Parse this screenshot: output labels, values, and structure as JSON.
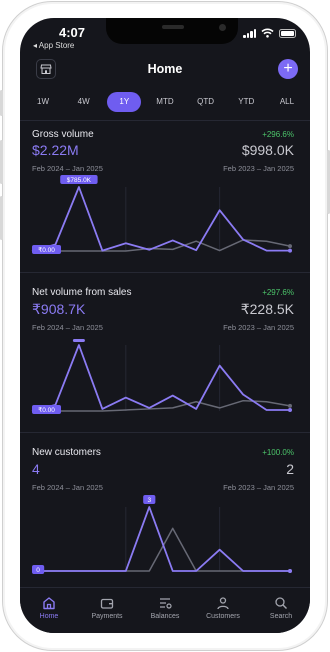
{
  "status": {
    "time": "4:07",
    "back_app": "◂ App Store"
  },
  "header": {
    "title": "Home",
    "add_label": "+"
  },
  "tabs": [
    "1W",
    "4W",
    "1Y",
    "MTD",
    "QTD",
    "YTD",
    "ALL"
  ],
  "active_tab": "1Y",
  "cards": [
    {
      "title": "Gross volume",
      "change": "+296.6%",
      "value": "$2.22M",
      "previous": "$998.0K",
      "range_current": "Feb 2024 – Jan 2025",
      "range_previous": "Feb 2023 – Jan 2025",
      "chart_data": {
        "type": "line",
        "max_label": "$785.0K",
        "min_label": "₹0.00",
        "series": [
          {
            "values": [
              0,
              80,
              785,
              5,
              95,
              15,
              130,
              10,
              500,
              140,
              5,
              5
            ]
          },
          {
            "values": [
              0,
              0,
              0,
              0,
              0,
              30,
              20,
              120,
              5,
              135,
              120,
              60
            ]
          }
        ]
      }
    },
    {
      "title": "Net volume from sales",
      "change": "+297.6%",
      "value": "₹908.7K",
      "previous": "₹228.5K",
      "range_current": "Feb 2024 – Jan 2025",
      "range_previous": "Feb 2023 – Jan 2025",
      "chart_data": {
        "type": "line",
        "max_label": "",
        "min_label": "₹0.00",
        "series": [
          {
            "values": [
              0,
              30,
              320,
              10,
              65,
              15,
              75,
              10,
              220,
              80,
              5,
              5
            ]
          },
          {
            "values": [
              0,
              0,
              0,
              0,
              5,
              10,
              15,
              45,
              15,
              50,
              45,
              25
            ]
          }
        ]
      }
    },
    {
      "title": "New customers",
      "change": "+100.0%",
      "value": "4",
      "previous": "2",
      "range_current": "Feb 2024 – Jan 2025",
      "range_previous": "Feb 2023 – Jan 2025",
      "chart_data": {
        "type": "line",
        "max_label": "3",
        "min_label": "0",
        "series": [
          {
            "values": [
              0,
              0,
              0,
              0,
              0,
              3,
              0,
              0,
              1,
              0,
              0,
              0
            ]
          },
          {
            "values": [
              0,
              0,
              0,
              0,
              0,
              0,
              2,
              0,
              0,
              0,
              0,
              0
            ]
          }
        ]
      }
    }
  ],
  "tabbar": [
    "Home",
    "Payments",
    "Balances",
    "Customers",
    "Search"
  ],
  "colors": {
    "accent": "#8b7bf3",
    "positive": "#4cc46a",
    "secondary_series": "#676975",
    "background": "#15161c"
  }
}
